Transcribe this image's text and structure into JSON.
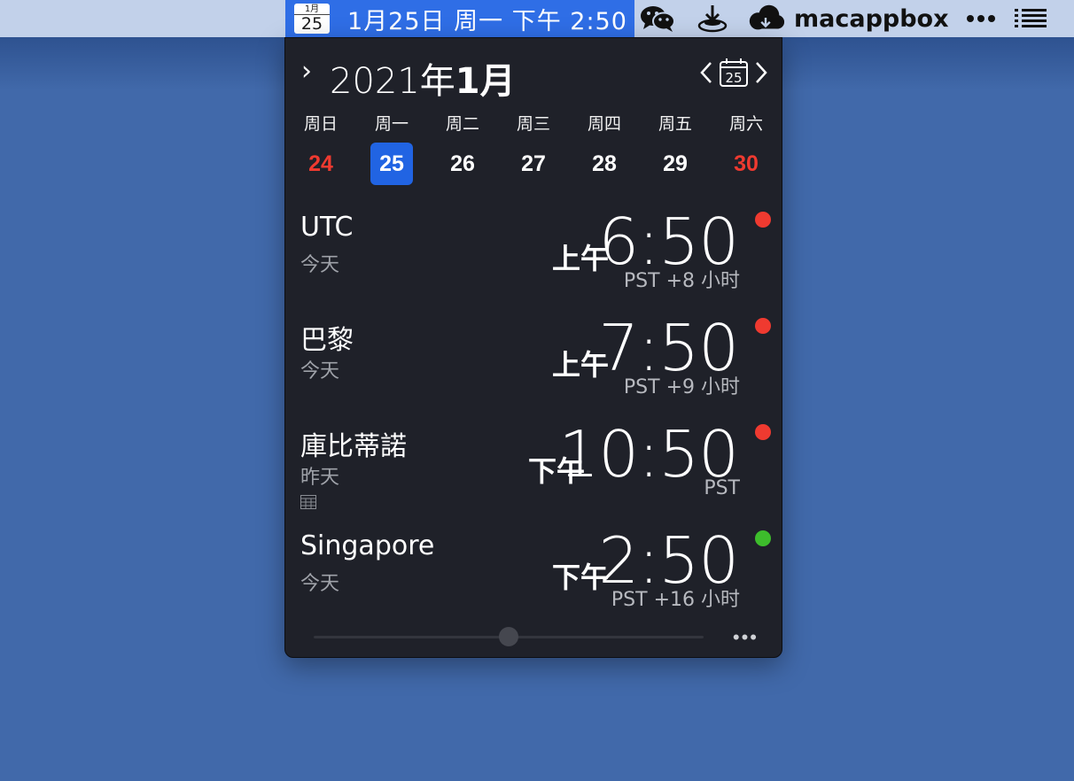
{
  "menubar": {
    "cal_icon_month": "1月",
    "cal_icon_day": "25",
    "date_text": "1月25日 周一  下午 2:50",
    "user": "macappbox",
    "icons": [
      "wechat-icon",
      "download-icon",
      "cloud-icon",
      "more-icon",
      "list-icon"
    ],
    "accent": "#2f6ee6"
  },
  "panel": {
    "expand_glyph": "›",
    "year_label": "2021年",
    "month_label": "1月",
    "today_icon_day": "25",
    "weekdays": [
      "周日",
      "周一",
      "周二",
      "周三",
      "周四",
      "周五",
      "周六"
    ],
    "days": [
      "24",
      "25",
      "26",
      "27",
      "28",
      "29",
      "30"
    ],
    "today_index": 1,
    "zones": [
      {
        "city": "UTC",
        "relative_day": "今天",
        "ampm": "上午",
        "time": "6:50",
        "offset": "PST +8 小时",
        "status_color": "#ef3a30"
      },
      {
        "city": "巴黎",
        "relative_day": "今天",
        "ampm": "上午",
        "time": "7:50",
        "offset": "PST +9 小时",
        "status_color": "#ef3a30"
      },
      {
        "city": "庫比蒂諾",
        "relative_day": "昨天",
        "ampm": "下午",
        "time": "10:50",
        "offset": "PST",
        "status_color": "#ef3a30",
        "has_calendar_icon": true
      },
      {
        "city": "Singapore",
        "relative_day": "今天",
        "ampm": "下午",
        "time": "2:50",
        "offset": "PST +16 小时",
        "status_color": "#3dbd2c"
      }
    ],
    "more_label": "•••",
    "slider_value": 0.5
  },
  "colors": {
    "desktop": "#4169aa",
    "panel_bg": "#1f2129",
    "weekend": "#ef3a30",
    "today": "#2164e3"
  }
}
